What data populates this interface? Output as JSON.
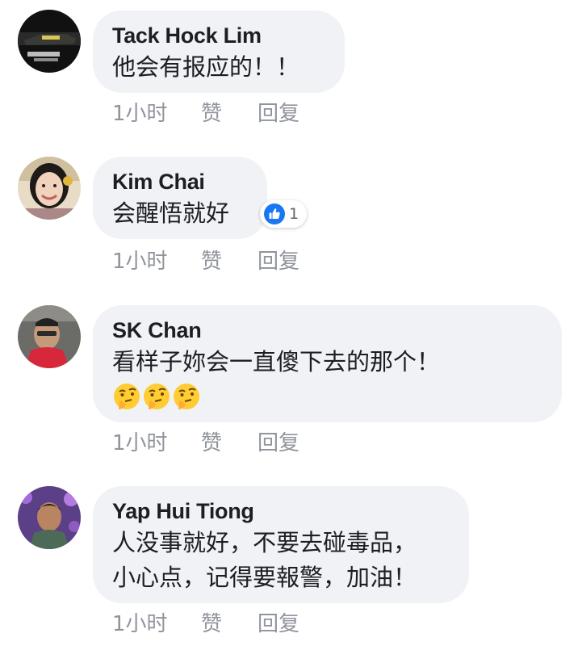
{
  "comments": [
    {
      "author": "Tack Hock Lim",
      "text": "他会有报应的！！",
      "time": "1小时",
      "like": "赞",
      "reply": "回复"
    },
    {
      "author": "Kim Chai",
      "text": "会醒悟就好",
      "reaction": {
        "icon": "thumbs-up-icon",
        "count": "1",
        "color": "#1877f2"
      },
      "time": "1小时",
      "like": "赞",
      "reply": "回复"
    },
    {
      "author": "SK Chan",
      "text": "看样子妳会一直傻下去的那个！",
      "emojis": [
        "thinking-face-icon",
        "thinking-face-icon",
        "thinking-face-icon"
      ],
      "time": "1小时",
      "like": "赞",
      "reply": "回复"
    },
    {
      "author": "Yap Hui Tiong",
      "text_lines": [
        "人没事就好，不要去碰毒品，",
        "小心点，记得要報警，加油！"
      ],
      "time": "1小时",
      "like": "赞",
      "reply": "回复"
    }
  ],
  "colors": {
    "bubble": "#f0f2f5",
    "meta_text": "#90949c",
    "name_text": "#1c1e21",
    "like_blue": "#1877f2"
  }
}
